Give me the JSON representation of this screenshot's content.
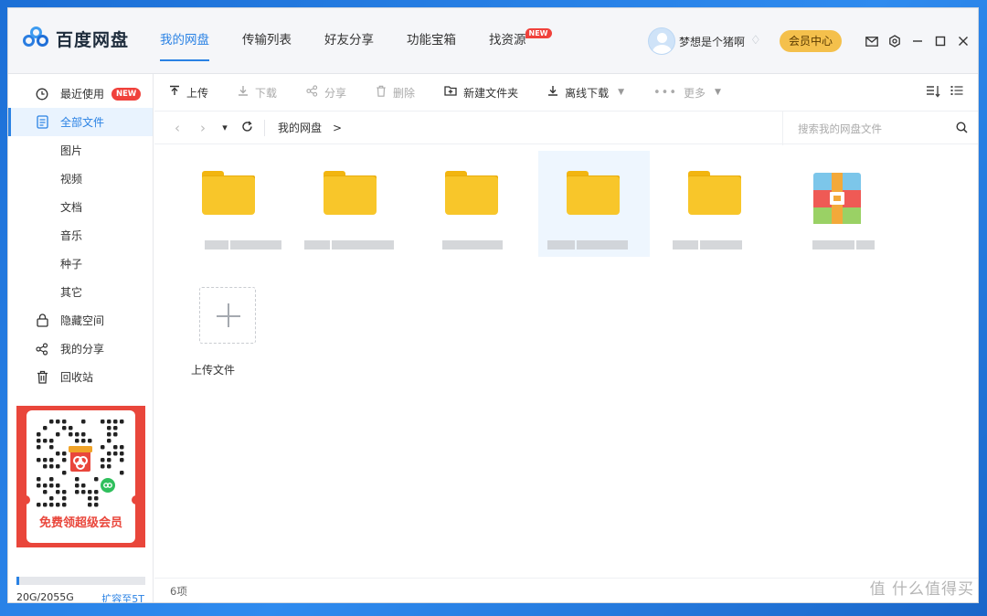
{
  "app": {
    "name": "百度网盘",
    "nav": [
      {
        "label": "我的网盘",
        "active": true
      },
      {
        "label": "传输列表"
      },
      {
        "label": "好友分享"
      },
      {
        "label": "功能宝箱"
      },
      {
        "label": "找资源",
        "badge": "NEW"
      }
    ],
    "user": {
      "name": "梦想是个猪啊"
    },
    "vip_button": "会员中心",
    "accent": "#2a82e4"
  },
  "sidebar": {
    "items": [
      {
        "label": "最近使用",
        "badge": "NEW",
        "icon": "clock-icon"
      },
      {
        "label": "全部文件",
        "icon": "document-icon",
        "active": true
      },
      {
        "label": "图片"
      },
      {
        "label": "视频"
      },
      {
        "label": "文档"
      },
      {
        "label": "音乐"
      },
      {
        "label": "种子"
      },
      {
        "label": "其它"
      },
      {
        "label": "隐藏空间",
        "icon": "lock-icon"
      },
      {
        "label": "我的分享",
        "icon": "share-icon"
      },
      {
        "label": "回收站",
        "icon": "trash-icon"
      }
    ],
    "promo_text": "免费领超级会员",
    "quota": {
      "used_text": "20G/2055G",
      "expand_link": "扩容至5T",
      "used_fraction": 0.0097
    }
  },
  "toolbar": {
    "upload": "上传",
    "download": "下载",
    "share": "分享",
    "delete": "删除",
    "new_folder": "新建文件夹",
    "offline_download": "离线下载",
    "more": "更多"
  },
  "pathbar": {
    "crumb": "我的网盘",
    "separator": ">",
    "search_placeholder": "搜索我的网盘文件"
  },
  "content": {
    "upload_label": "上传文件",
    "item_count": "6项"
  },
  "watermark": "值 什么值得买"
}
